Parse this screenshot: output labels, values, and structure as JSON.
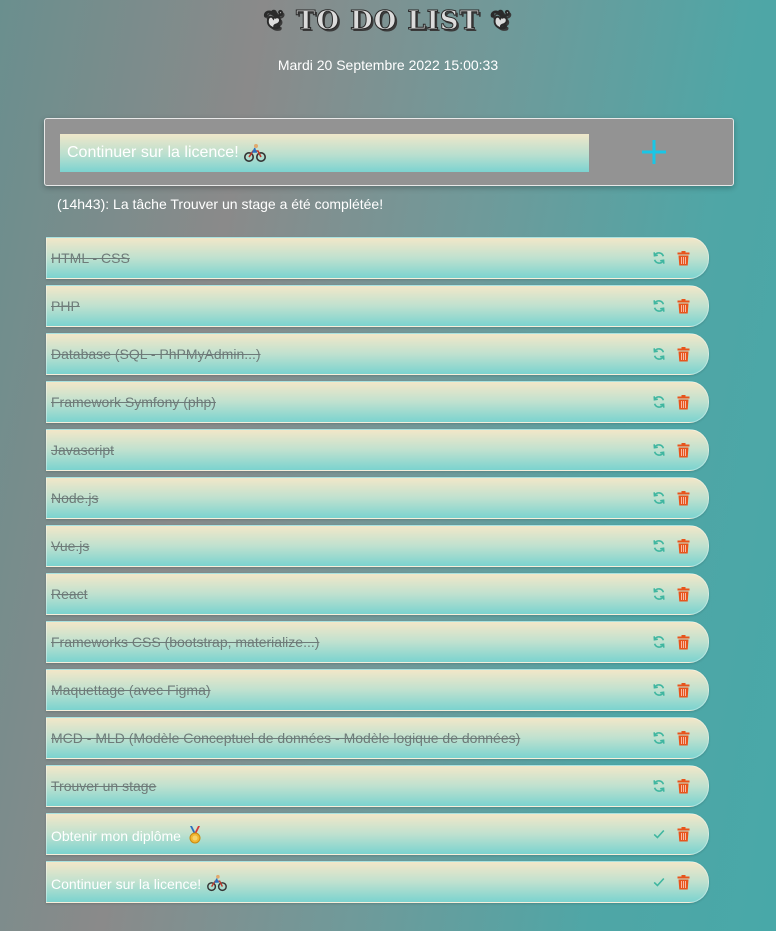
{
  "header": {
    "title": "❦ TO DO LIST ❦",
    "datetime": "Mardi 20 Septembre 2022 15:00:33"
  },
  "add_form": {
    "input_value": "Continuer sur la licence!",
    "input_emoji": "cyclist-emoji-icon",
    "add_icon": "plus-icon"
  },
  "message": "(14h43): La tâche Trouver un stage a été complétée!",
  "colors": {
    "done_text": "#6e7b79",
    "restore_icon": "#3fb6a0",
    "check_icon": "#3fb6a0",
    "trash_icon": "#e8541c",
    "plus_icon": "#19c6e6"
  },
  "tasks": [
    {
      "label": "HTML - CSS",
      "done": true,
      "action_icon": "refresh-icon"
    },
    {
      "label": "PHP",
      "done": true,
      "action_icon": "refresh-icon"
    },
    {
      "label": "Database (SQL - PhPMyAdmin...)",
      "done": true,
      "action_icon": "refresh-icon"
    },
    {
      "label": "Framework Symfony (php)",
      "done": true,
      "action_icon": "refresh-icon"
    },
    {
      "label": "Javascript",
      "done": true,
      "action_icon": "refresh-icon"
    },
    {
      "label": "Node.js",
      "done": true,
      "action_icon": "refresh-icon"
    },
    {
      "label": "Vue.js",
      "done": true,
      "action_icon": "refresh-icon"
    },
    {
      "label": "React",
      "done": true,
      "action_icon": "refresh-icon"
    },
    {
      "label": "Frameworks CSS (bootstrap, materialize...)",
      "done": true,
      "action_icon": "refresh-icon"
    },
    {
      "label": "Maquettage (avec Figma)",
      "done": true,
      "action_icon": "refresh-icon"
    },
    {
      "label": "MCD - MLD (Modèle Conceptuel de données - Modèle logique de données)",
      "done": true,
      "action_icon": "refresh-icon"
    },
    {
      "label": "Trouver un stage",
      "done": true,
      "action_icon": "refresh-icon"
    },
    {
      "label": "Obtenir mon diplôme",
      "done": false,
      "action_icon": "check-icon",
      "emoji": "medal-emoji-icon"
    },
    {
      "label": "Continuer sur la licence!",
      "done": false,
      "action_icon": "check-icon",
      "emoji": "cyclist-emoji-icon"
    }
  ]
}
